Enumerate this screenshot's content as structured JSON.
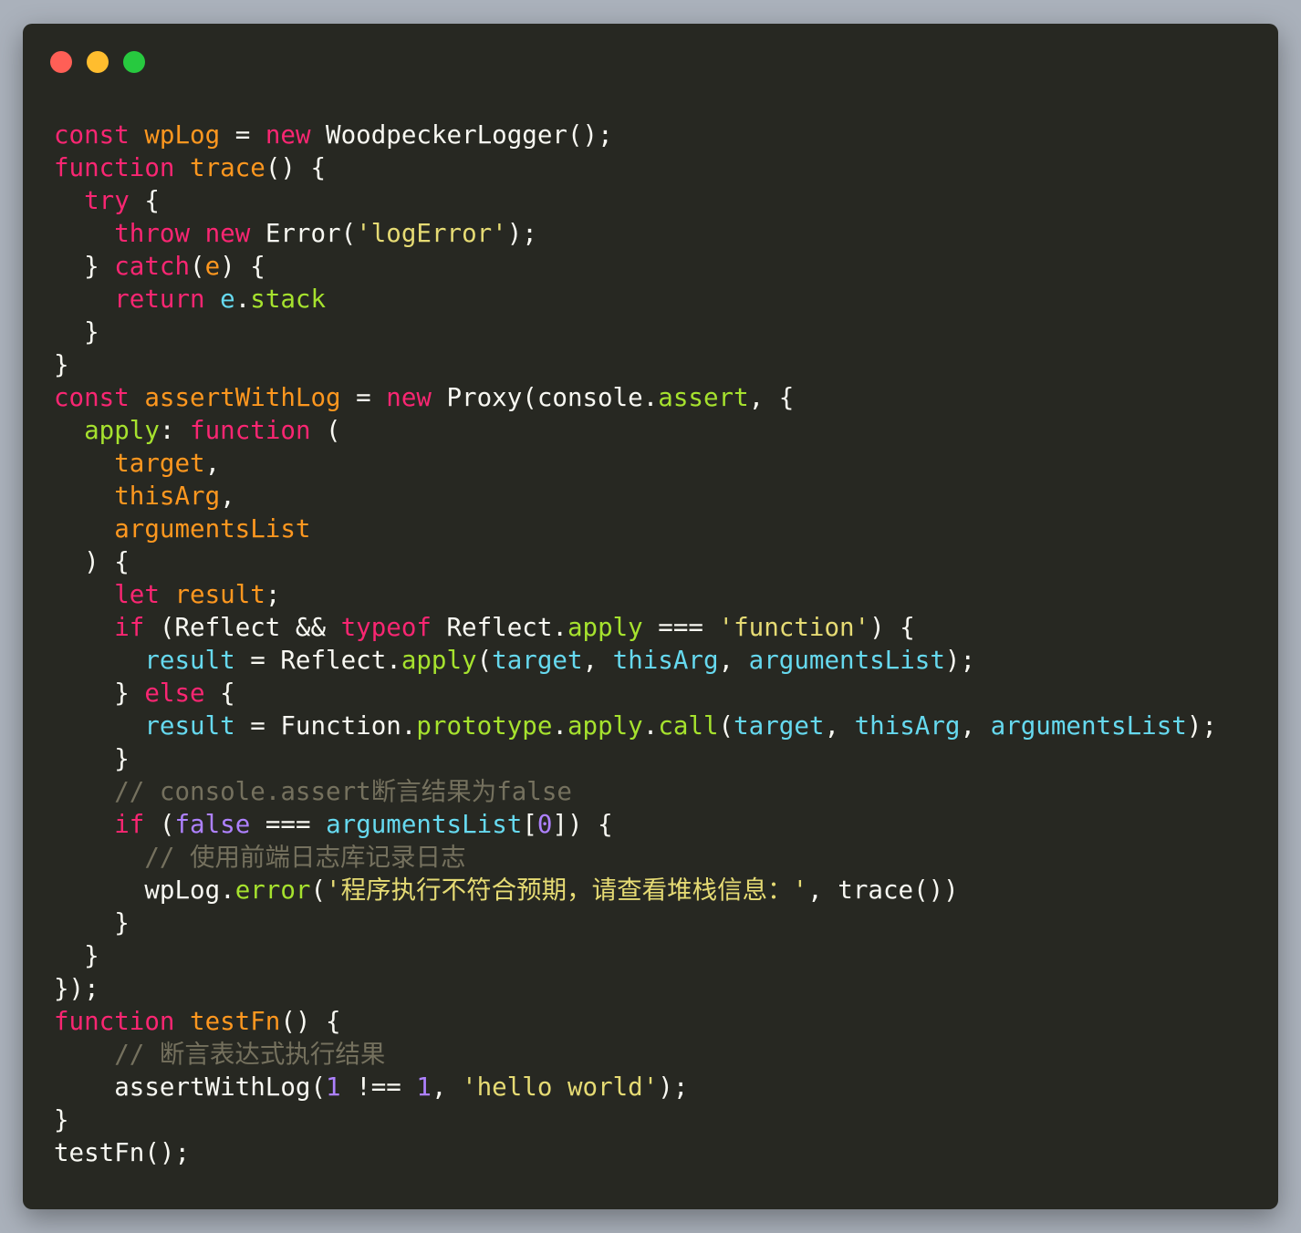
{
  "window": {
    "buttons": [
      "close",
      "minimize",
      "maximize"
    ]
  },
  "colors": {
    "keyword": "#f92672",
    "declaration": "#fd971f",
    "property": "#a6e22e",
    "string": "#e6db74",
    "variable": "#66d9ef",
    "literal": "#ae81ff",
    "comment": "#75715e",
    "plain": "#f8f8f2",
    "background": "#272822"
  },
  "code": {
    "lines": [
      [
        [
          "k",
          "const"
        ],
        [
          "t",
          " "
        ],
        [
          "d",
          "wpLog"
        ],
        [
          "t",
          " = "
        ],
        [
          "k",
          "new"
        ],
        [
          "t",
          " WoodpeckerLogger();"
        ]
      ],
      [
        [
          "k",
          "function"
        ],
        [
          "t",
          " "
        ],
        [
          "d",
          "trace"
        ],
        [
          "t",
          "() {"
        ]
      ],
      [
        [
          "t",
          "  "
        ],
        [
          "k",
          "try"
        ],
        [
          "t",
          " {"
        ]
      ],
      [
        [
          "t",
          "    "
        ],
        [
          "k",
          "throw"
        ],
        [
          "t",
          " "
        ],
        [
          "k",
          "new"
        ],
        [
          "t",
          " Error("
        ],
        [
          "s",
          "'logError'"
        ],
        [
          "t",
          ");"
        ]
      ],
      [
        [
          "t",
          "  } "
        ],
        [
          "k",
          "catch"
        ],
        [
          "t",
          "("
        ],
        [
          "d",
          "e"
        ],
        [
          "t",
          ") {"
        ]
      ],
      [
        [
          "t",
          "    "
        ],
        [
          "k",
          "return"
        ],
        [
          "t",
          " "
        ],
        [
          "v",
          "e"
        ],
        [
          "t",
          "."
        ],
        [
          "p",
          "stack"
        ]
      ],
      [
        [
          "t",
          "  }"
        ]
      ],
      [
        [
          "t",
          "}"
        ]
      ],
      [
        [
          "k",
          "const"
        ],
        [
          "t",
          " "
        ],
        [
          "d",
          "assertWithLog"
        ],
        [
          "t",
          " = "
        ],
        [
          "k",
          "new"
        ],
        [
          "t",
          " Proxy(console."
        ],
        [
          "p",
          "assert"
        ],
        [
          "t",
          ", {"
        ]
      ],
      [
        [
          "t",
          "  "
        ],
        [
          "p",
          "apply"
        ],
        [
          "t",
          ": "
        ],
        [
          "k",
          "function"
        ],
        [
          "t",
          " ("
        ]
      ],
      [
        [
          "t",
          "    "
        ],
        [
          "d",
          "target"
        ],
        [
          "t",
          ","
        ]
      ],
      [
        [
          "t",
          "    "
        ],
        [
          "d",
          "thisArg"
        ],
        [
          "t",
          ","
        ]
      ],
      [
        [
          "t",
          "    "
        ],
        [
          "d",
          "argumentsList"
        ]
      ],
      [
        [
          "t",
          "  ) {"
        ]
      ],
      [
        [
          "t",
          "    "
        ],
        [
          "k",
          "let"
        ],
        [
          "t",
          " "
        ],
        [
          "d",
          "result"
        ],
        [
          "t",
          ";"
        ]
      ],
      [
        [
          "t",
          "    "
        ],
        [
          "k",
          "if"
        ],
        [
          "t",
          " (Reflect && "
        ],
        [
          "k",
          "typeof"
        ],
        [
          "t",
          " Reflect."
        ],
        [
          "p",
          "apply"
        ],
        [
          "t",
          " === "
        ],
        [
          "s",
          "'function'"
        ],
        [
          "t",
          ") {"
        ]
      ],
      [
        [
          "t",
          "      "
        ],
        [
          "v",
          "result"
        ],
        [
          "t",
          " = Reflect."
        ],
        [
          "p",
          "apply"
        ],
        [
          "t",
          "("
        ],
        [
          "v",
          "target"
        ],
        [
          "t",
          ", "
        ],
        [
          "v",
          "thisArg"
        ],
        [
          "t",
          ", "
        ],
        [
          "v",
          "argumentsList"
        ],
        [
          "t",
          ");"
        ]
      ],
      [
        [
          "t",
          "    } "
        ],
        [
          "k",
          "else"
        ],
        [
          "t",
          " {"
        ]
      ],
      [
        [
          "t",
          "      "
        ],
        [
          "v",
          "result"
        ],
        [
          "t",
          " = Function."
        ],
        [
          "p",
          "prototype"
        ],
        [
          "t",
          "."
        ],
        [
          "p",
          "apply"
        ],
        [
          "t",
          "."
        ],
        [
          "p",
          "call"
        ],
        [
          "t",
          "("
        ],
        [
          "v",
          "target"
        ],
        [
          "t",
          ", "
        ],
        [
          "v",
          "thisArg"
        ],
        [
          "t",
          ", "
        ],
        [
          "v",
          "argumentsList"
        ],
        [
          "t",
          ");"
        ]
      ],
      [
        [
          "t",
          "    }"
        ]
      ],
      [
        [
          "t",
          "    "
        ],
        [
          "c",
          "// console.assert断言结果为false"
        ]
      ],
      [
        [
          "t",
          "    "
        ],
        [
          "k",
          "if"
        ],
        [
          "t",
          " ("
        ],
        [
          "n",
          "false"
        ],
        [
          "t",
          " === "
        ],
        [
          "v",
          "argumentsList"
        ],
        [
          "t",
          "["
        ],
        [
          "n",
          "0"
        ],
        [
          "t",
          "]) {"
        ]
      ],
      [
        [
          "t",
          "      "
        ],
        [
          "c",
          "// 使用前端日志库记录日志"
        ]
      ],
      [
        [
          "t",
          "      wpLog."
        ],
        [
          "p",
          "error"
        ],
        [
          "t",
          "("
        ],
        [
          "s",
          "'程序执行不符合预期，请查看堆栈信息：'"
        ],
        [
          "t",
          ", trace())"
        ]
      ],
      [
        [
          "t",
          "    }"
        ]
      ],
      [
        [
          "t",
          "  }"
        ]
      ],
      [
        [
          "t",
          "});"
        ]
      ],
      [
        [
          "k",
          "function"
        ],
        [
          "t",
          " "
        ],
        [
          "d",
          "testFn"
        ],
        [
          "t",
          "() {"
        ]
      ],
      [
        [
          "t",
          "    "
        ],
        [
          "c",
          "// 断言表达式执行结果"
        ]
      ],
      [
        [
          "t",
          "    assertWithLog("
        ],
        [
          "n",
          "1"
        ],
        [
          "t",
          " !== "
        ],
        [
          "n",
          "1"
        ],
        [
          "t",
          ", "
        ],
        [
          "s",
          "'hello world'"
        ],
        [
          "t",
          ");"
        ]
      ],
      [
        [
          "t",
          "}"
        ]
      ],
      [
        [
          "t",
          "testFn();"
        ]
      ]
    ]
  }
}
